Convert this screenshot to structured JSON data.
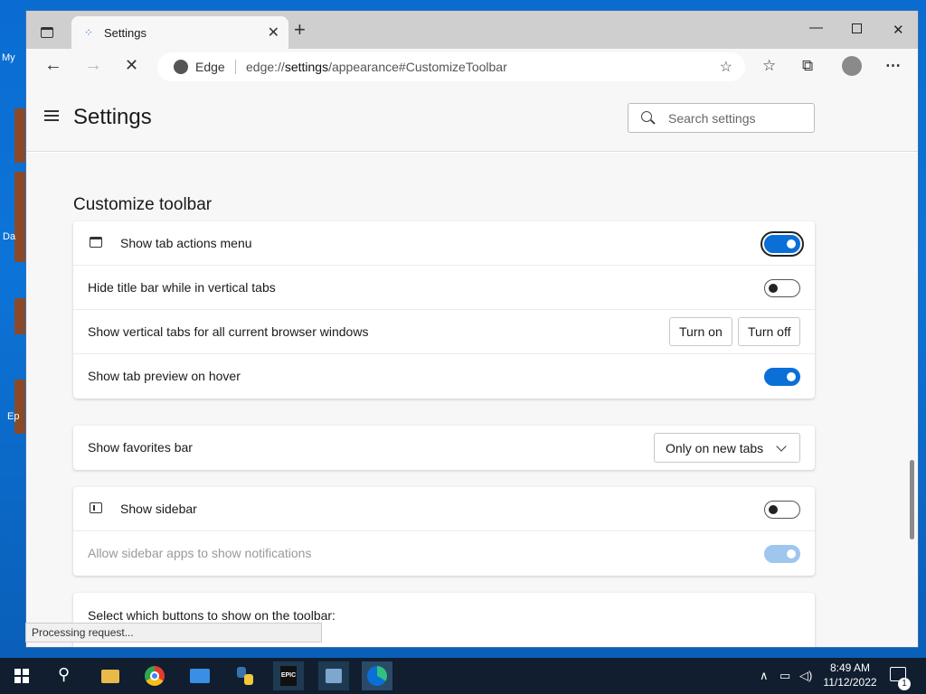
{
  "desktop": {
    "labels": [
      "My",
      "Da",
      "Ep"
    ]
  },
  "browser": {
    "tab": {
      "title": "Settings"
    },
    "address": {
      "site_label": "Edge",
      "url_prefix": "edge://",
      "url_path": "settings",
      "url_suffix": "/appearance#CustomizeToolbar"
    },
    "status_text": "Processing request..."
  },
  "settings": {
    "title": "Settings",
    "search": {
      "placeholder": "Search settings"
    },
    "section_title": "Customize toolbar",
    "group1": [
      {
        "label": "Show tab actions menu",
        "state": "on"
      },
      {
        "label": "Hide title bar while in vertical tabs",
        "state": "off"
      },
      {
        "label": "Show vertical tabs for all current browser windows",
        "turn_on": "Turn on",
        "turn_off": "Turn off"
      },
      {
        "label": "Show tab preview on hover",
        "state": "on"
      }
    ],
    "favorites_bar": {
      "label": "Show favorites bar",
      "value": "Only on new tabs"
    },
    "sidebar": [
      {
        "label": "Show sidebar",
        "state": "off"
      },
      {
        "label": "Allow sidebar apps to show notifications",
        "state": "on-disabled"
      }
    ],
    "toolbar_buttons_heading": "Select which buttons to show on the toolbar:"
  },
  "taskbar": {
    "time": "8:49 AM",
    "date": "11/12/2022",
    "notification_count": "1",
    "epic_label": "EPIC"
  },
  "colors": {
    "accent": "#0a6fd6",
    "taskbar": "#101e30"
  }
}
